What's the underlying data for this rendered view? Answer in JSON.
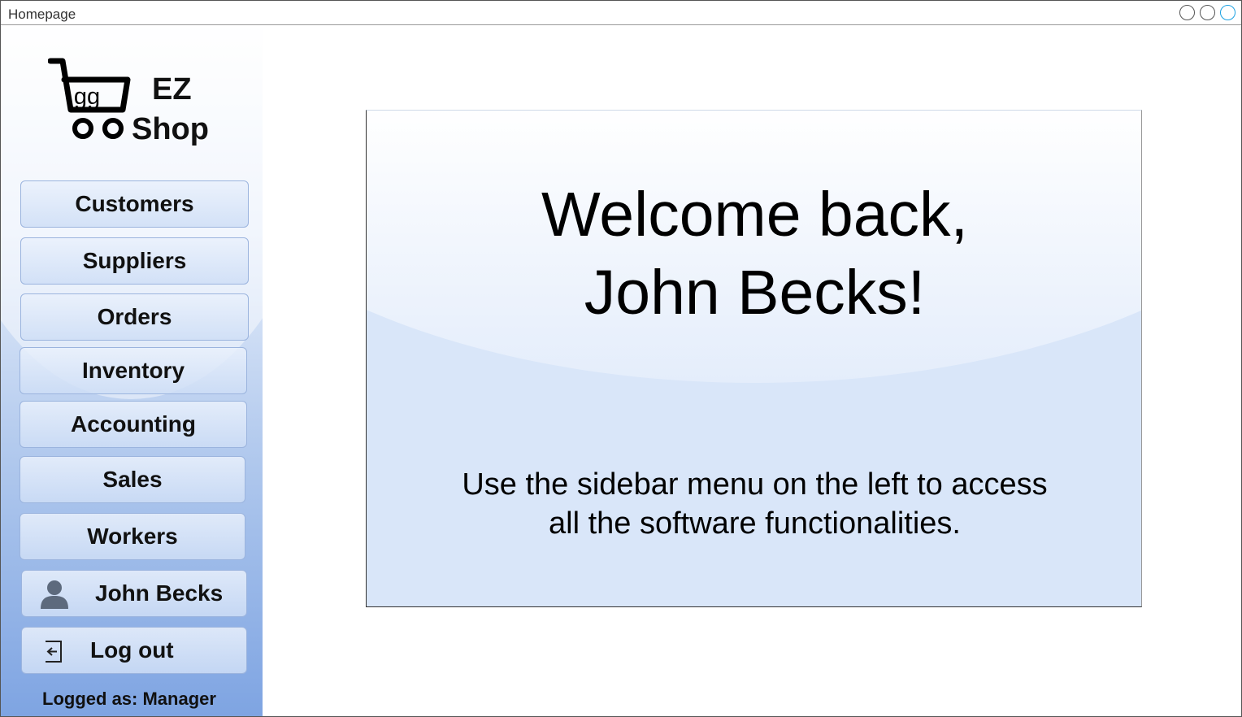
{
  "window": {
    "title": "Homepage"
  },
  "logo": {
    "cart_text": "gg",
    "line1": "EZ",
    "line2": "Shop"
  },
  "sidebar": {
    "items": [
      {
        "label": "Customers"
      },
      {
        "label": "Suppliers"
      },
      {
        "label": "Orders"
      },
      {
        "label": "Inventory"
      },
      {
        "label": "Accounting"
      },
      {
        "label": "Sales"
      },
      {
        "label": "Workers"
      }
    ],
    "user": {
      "label": "John Becks",
      "icon": "user-icon"
    },
    "logout": {
      "label": "Log out",
      "icon": "logout-icon"
    },
    "logged_as": "Logged as: Manager"
  },
  "main": {
    "welcome_line1": "Welcome back,",
    "welcome_line2": "John Becks!",
    "hint_line1": "Use the sidebar menu on the left to access",
    "hint_line2": "all the software functionalities."
  },
  "colors": {
    "sidebar_top": "#ffffff",
    "sidebar_bottom": "#7ea4e2",
    "panel_background": "#d9e6f9",
    "button_border": "#9bb4de"
  }
}
